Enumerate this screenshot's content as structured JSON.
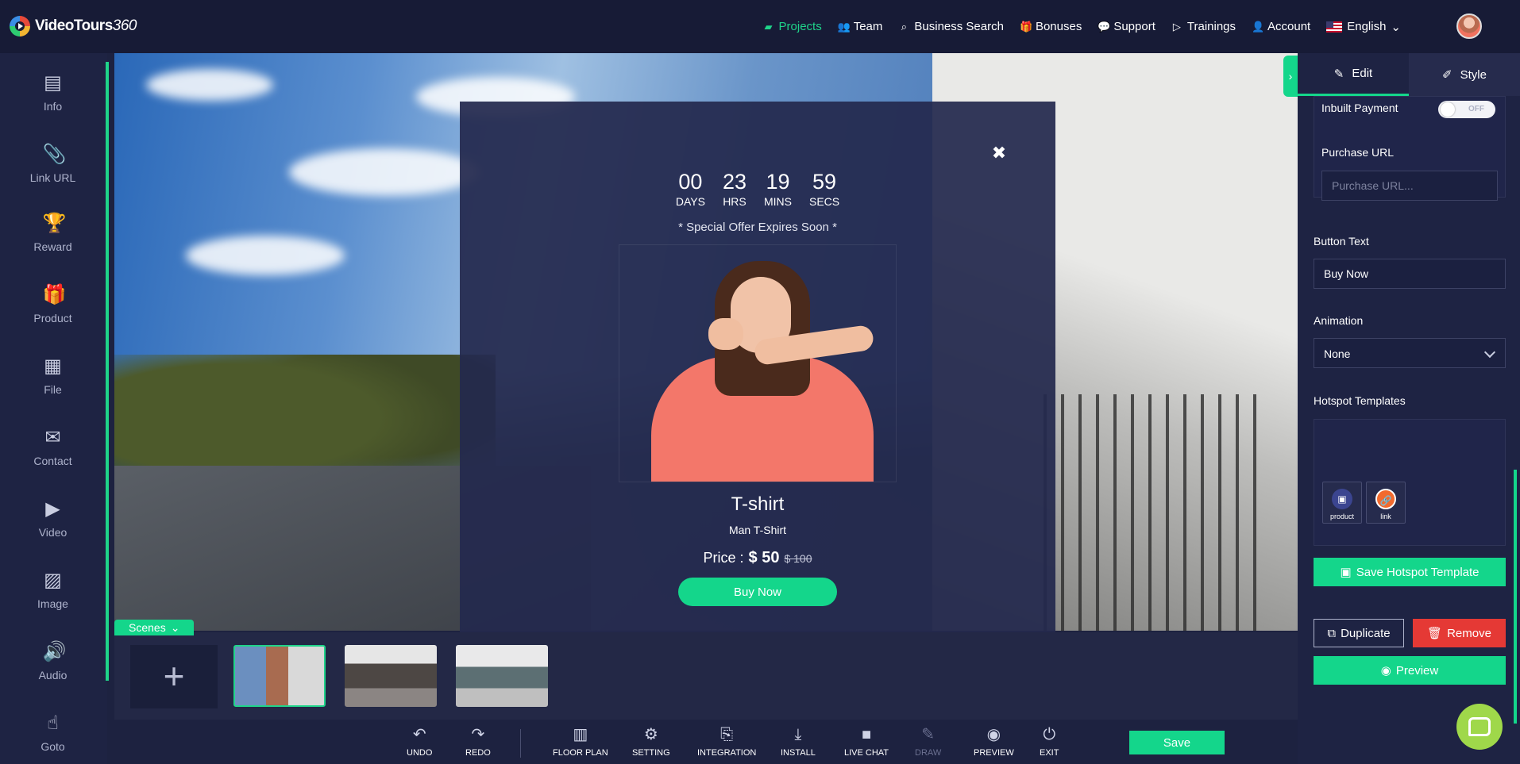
{
  "app": {
    "brand": "VideoTours",
    "brand_suffix": "360"
  },
  "nav": {
    "items": [
      {
        "label": "Projects",
        "icon": "folder-icon",
        "glyph": "▰"
      },
      {
        "label": "Team",
        "icon": "users-icon",
        "glyph": "👥"
      },
      {
        "label": "Business Search",
        "icon": "search-icon",
        "glyph": "⌕"
      },
      {
        "label": "Bonuses",
        "icon": "gift-icon",
        "glyph": "🎁"
      },
      {
        "label": "Support",
        "icon": "chat-icon",
        "glyph": "💬"
      },
      {
        "label": "Trainings",
        "icon": "play-square-icon",
        "glyph": "▷"
      },
      {
        "label": "Account",
        "icon": "user-icon",
        "glyph": "👤"
      },
      {
        "label": "English",
        "icon": "us-flag-icon",
        "glyph": ""
      }
    ],
    "active_color": "#1fd48a"
  },
  "sidebar": {
    "items": [
      {
        "label": "Info",
        "icon": "info-card-icon",
        "glyph": "▤"
      },
      {
        "label": "Link URL",
        "icon": "paperclip-icon",
        "glyph": "📎"
      },
      {
        "label": "Reward",
        "icon": "trophy-icon",
        "glyph": "🏆"
      },
      {
        "label": "Product",
        "icon": "gift-icon",
        "glyph": "🎁"
      },
      {
        "label": "File",
        "icon": "calendar-icon",
        "glyph": "▦"
      },
      {
        "label": "Contact",
        "icon": "envelope-icon",
        "glyph": "✉"
      },
      {
        "label": "Video",
        "icon": "video-icon",
        "glyph": "▶"
      },
      {
        "label": "Image",
        "icon": "image-icon",
        "glyph": "▨"
      },
      {
        "label": "Audio",
        "icon": "speaker-icon",
        "glyph": "🔊"
      },
      {
        "label": "Goto",
        "icon": "hand-pointer-icon",
        "glyph": "☝"
      }
    ]
  },
  "modal": {
    "countdown": [
      {
        "value": "00",
        "label": "DAYS"
      },
      {
        "value": "23",
        "label": "HRS"
      },
      {
        "value": "19",
        "label": "MINS"
      },
      {
        "value": "59",
        "label": "SECS"
      }
    ],
    "expires_text": "* Special Offer Expires Soon *",
    "product_title": "T-shirt",
    "product_subtitle": "Man T-Shirt",
    "price_label": "Price :",
    "price_now": "$ 50",
    "price_old": "$ 100",
    "buy_label": "Buy Now"
  },
  "scenes": {
    "tab_label": "Scenes",
    "add_label": "+"
  },
  "toolbar": {
    "tools": [
      {
        "label": "UNDO",
        "icon": "undo-icon",
        "glyph": "↶",
        "enabled": true
      },
      {
        "label": "REDO",
        "icon": "redo-icon",
        "glyph": "↷",
        "enabled": true
      },
      {
        "label": "FLOOR PLAN",
        "icon": "floor-plan-icon",
        "glyph": "▥",
        "enabled": true
      },
      {
        "label": "SETTING",
        "icon": "gear-icon",
        "glyph": "⚙",
        "enabled": true
      },
      {
        "label": "INTEGRATION",
        "icon": "integration-icon",
        "glyph": "⎘",
        "enabled": true
      },
      {
        "label": "INSTALL",
        "icon": "download-icon",
        "glyph": "⤓",
        "enabled": true
      },
      {
        "label": "LIVE CHAT",
        "icon": "camera-icon",
        "glyph": "■",
        "enabled": true
      },
      {
        "label": "DRAW",
        "icon": "draw-icon",
        "glyph": "✎",
        "enabled": false
      },
      {
        "label": "PREVIEW",
        "icon": "eye-icon",
        "glyph": "◉",
        "enabled": true
      },
      {
        "label": "EXIT",
        "icon": "power-icon",
        "glyph": "⏻",
        "enabled": true
      }
    ],
    "save_label": "Save"
  },
  "panel": {
    "tabs": [
      {
        "label": "Edit",
        "icon": "edit-icon",
        "glyph": "✎"
      },
      {
        "label": "Style",
        "icon": "brush-icon",
        "glyph": "✐"
      }
    ],
    "inbuilt_payment_label": "Inbuilt Payment",
    "inbuilt_payment_state": "OFF",
    "purchase_url_label": "Purchase URL",
    "purchase_url_placeholder": "Purchase URL...",
    "button_text_label": "Button Text",
    "button_text_value": "Buy Now",
    "animation_label": "Animation",
    "animation_value": "None",
    "hotspot_templates_label": "Hotspot Templates",
    "templates": [
      {
        "label": "product",
        "icon": "lock-icon",
        "glyph": "▣",
        "color": "#3b4590"
      },
      {
        "label": "link",
        "icon": "link-icon",
        "glyph": "🔗",
        "color": "#f26a2e"
      }
    ],
    "save_template_label": "Save Hotspot Template",
    "duplicate_label": "Duplicate",
    "remove_label": "Remove",
    "preview_label": "Preview"
  }
}
